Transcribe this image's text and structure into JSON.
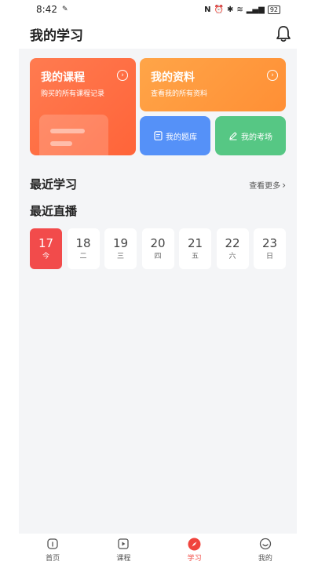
{
  "status": {
    "time": "8:42",
    "battery": "92"
  },
  "header": {
    "title": "我的学习"
  },
  "cards": {
    "course": {
      "title": "我的课程",
      "sub": "购买的所有课程记录"
    },
    "material": {
      "title": "我的资料",
      "sub": "查看我的所有资料"
    },
    "bank": {
      "label": "我的题库"
    },
    "exam": {
      "label": "我的考场"
    }
  },
  "sections": {
    "recent_study": "最近学习",
    "more": "查看更多",
    "recent_live": "最近直播"
  },
  "days": [
    {
      "num": "17",
      "wk": "今",
      "active": true
    },
    {
      "num": "18",
      "wk": "二"
    },
    {
      "num": "19",
      "wk": "三"
    },
    {
      "num": "20",
      "wk": "四"
    },
    {
      "num": "21",
      "wk": "五"
    },
    {
      "num": "22",
      "wk": "六"
    },
    {
      "num": "23",
      "wk": "日"
    }
  ],
  "tabs": [
    {
      "label": "首页",
      "icon": "home-icon"
    },
    {
      "label": "课程",
      "icon": "play-icon"
    },
    {
      "label": "学习",
      "icon": "compass-icon",
      "active": true
    },
    {
      "label": "我的",
      "icon": "smile-icon"
    }
  ],
  "colors": {
    "accent": "#f0443d",
    "course_card": "#ff6f45",
    "material_card": "#ff9a3e",
    "bank_card": "#5591f8",
    "exam_card": "#56c784"
  }
}
